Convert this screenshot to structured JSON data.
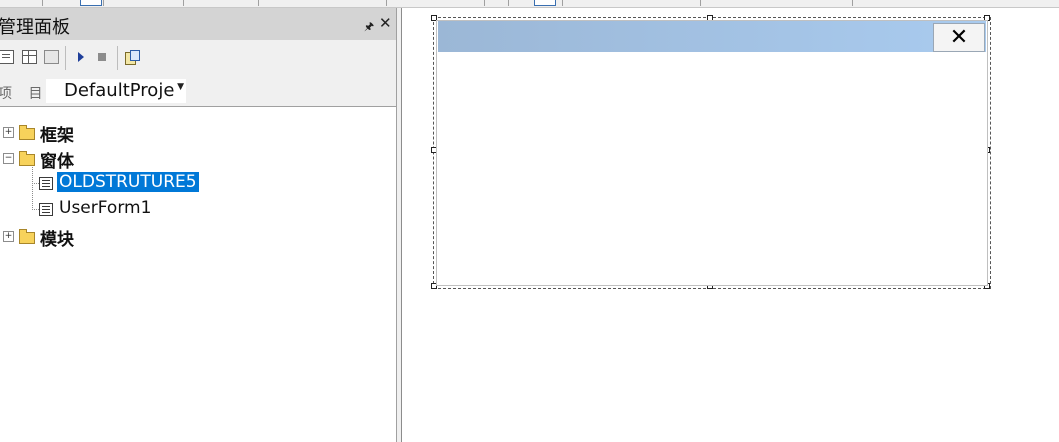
{
  "panel": {
    "title": "管理面板",
    "pin_icon": "pin-icon",
    "close_icon": "close-icon"
  },
  "toolbar": {
    "icons": [
      "view-code-icon",
      "view-object-icon",
      "toggle-folders-icon",
      "run-icon",
      "stop-icon",
      "properties-icon"
    ]
  },
  "project": {
    "label": "项 目",
    "value": "DefaultProject"
  },
  "tree": {
    "frames_folder": "框架",
    "forms_folder": "窗体",
    "forms": [
      "OLDSTRUTURE5",
      "UserForm1"
    ],
    "modules_folder": "模块"
  },
  "designer": {
    "close_glyph": "✕"
  },
  "colors": {
    "selection": "#0078d7",
    "titlebar_start": "#9bb7d6",
    "titlebar_end": "#a9cbef"
  }
}
